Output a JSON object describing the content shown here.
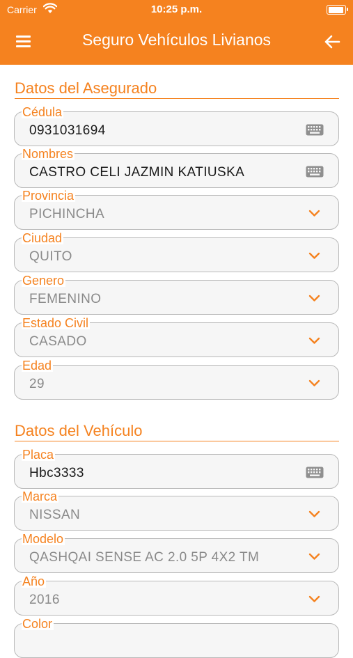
{
  "status_bar": {
    "carrier": "Carrier",
    "time": "10:25 p.m."
  },
  "header": {
    "title": "Seguro Vehículos Livianos"
  },
  "sections": {
    "asegurado": "Datos del Asegurado",
    "vehiculo": "Datos del Vehículo"
  },
  "fields": {
    "cedula": {
      "label": "Cédula",
      "value": "0931031694"
    },
    "nombres": {
      "label": "Nombres",
      "value": "CASTRO CELI JAZMIN KATIUSKA"
    },
    "provincia": {
      "label": "Provincia",
      "value": "PICHINCHA"
    },
    "ciudad": {
      "label": "Ciudad",
      "value": "QUITO"
    },
    "genero": {
      "label": "Genero",
      "value": "FEMENINO"
    },
    "estado_civil": {
      "label": "Estado Civil",
      "value": "CASADO"
    },
    "edad": {
      "label": "Edad",
      "value": "29"
    },
    "placa": {
      "label": "Placa",
      "value": "Hbc3333"
    },
    "marca": {
      "label": "Marca",
      "value": "NISSAN"
    },
    "modelo": {
      "label": "Modelo",
      "value": "QASHQAI SENSE AC 2.0 5P 4X2 TM"
    },
    "anio": {
      "label": "Año",
      "value": "2016"
    },
    "color": {
      "label": "Color"
    }
  },
  "icons": {
    "menu": "hamburger-icon",
    "back": "arrow-left-icon",
    "text_field": "keyboard-icon",
    "picker": "chevron-down-icon"
  },
  "colors": {
    "accent": "#f5821f",
    "field_bg": "#f6f6f6",
    "field_border": "#b8b8b8"
  }
}
